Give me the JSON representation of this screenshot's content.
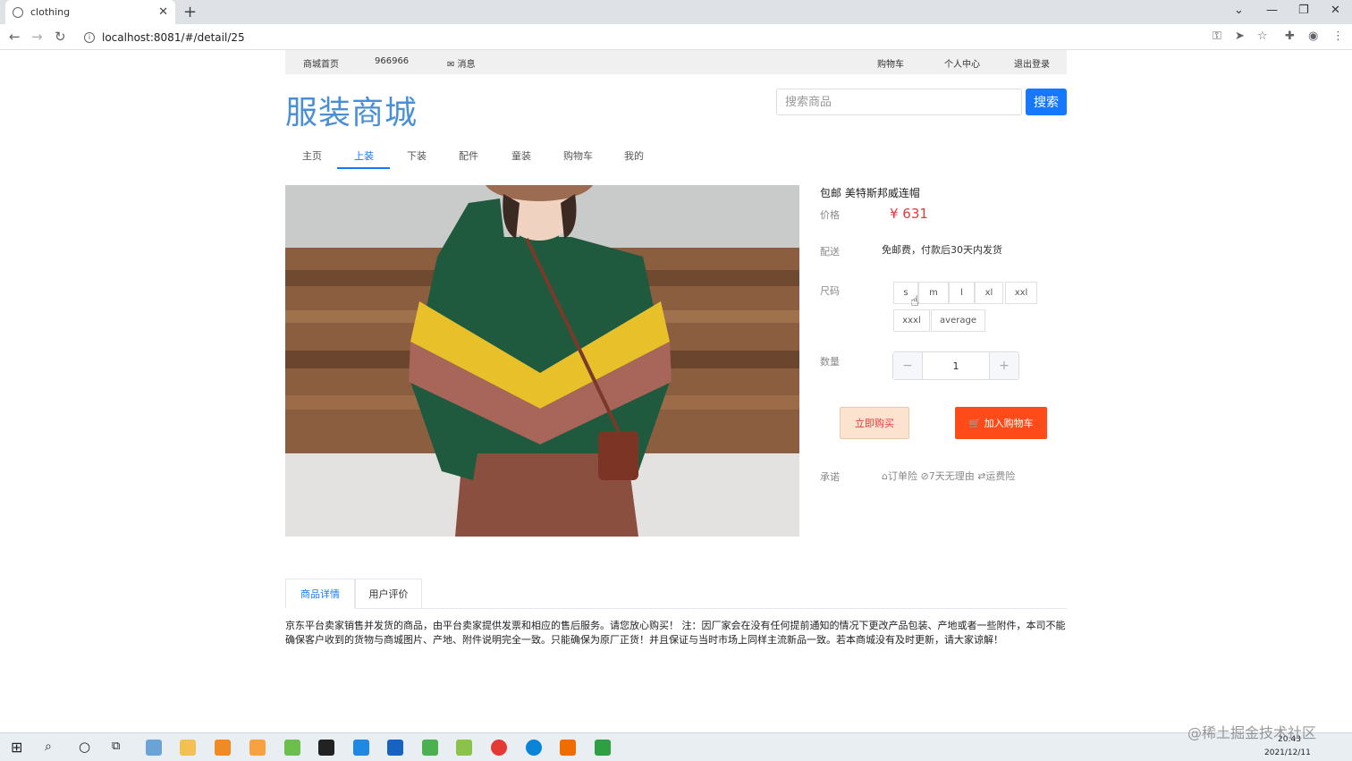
{
  "browser": {
    "tab_title": "clothing",
    "tab_close": "✕",
    "new_tab": "+",
    "url": "localhost:8081/#/detail/25",
    "min": "—",
    "max": "❐",
    "close": "✕",
    "chevron": "⌄"
  },
  "topbar": {
    "home": "商城首页",
    "user": "966966",
    "messages": "✉ 消息",
    "cart": "购物车",
    "profile": "个人中心",
    "logout": "退出登录"
  },
  "header": {
    "logo": "服装商城",
    "search_placeholder": "搜索商品",
    "search_button": "搜索"
  },
  "nav": {
    "items": [
      "主页",
      "上装",
      "下装",
      "配件",
      "童装",
      "购物车",
      "我的"
    ],
    "active_index": 1
  },
  "product": {
    "title": "包邮  美特斯邦威连帽",
    "price_label": "价格",
    "price": "¥ 631",
    "delivery_label": "配送",
    "delivery": "免邮费，付款后30天内发货",
    "size_label": "尺码",
    "sizes": [
      "s",
      "m",
      "l",
      "xl",
      "xxl",
      "xxxl",
      "average"
    ],
    "qty_label": "数量",
    "qty_minus": "−",
    "qty_value": "1",
    "qty_plus": "+",
    "buy_now": "立即购买",
    "add_to_cart": "🛒 加入购物车",
    "promise_label": "承诺",
    "promise": "⌂订单险 ⊘7天无理由 ⇄运费险"
  },
  "details": {
    "tabs": [
      "商品详情",
      "用户评价"
    ],
    "active_index": 0,
    "description": "京东平台卖家销售并发货的商品，由平台卖家提供发票和相应的售后服务。请您放心购买！ 注：因厂家会在没有任何提前通知的情况下更改产品包装、产地或者一些附件，本司不能确保客户收到的货物与商城图片、产地、附件说明完全一致。只能确保为原厂正货！并且保证与当时市场上同样主流新品一致。若本商城没有及时更新，请大家谅解！"
  },
  "taskbar": {
    "time": "20:43",
    "date": "2021/12/11"
  },
  "watermark": "@稀土掘金技术社区",
  "colors": {
    "accent": "#1677ff",
    "logo": "#4a8fd6",
    "price": "#e4393c",
    "add_cart": "#ff4b1a"
  }
}
